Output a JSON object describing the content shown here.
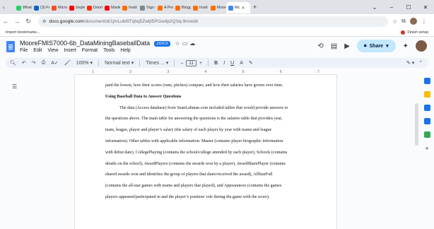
{
  "tabs": [
    {
      "label": "What",
      "color": "#25d366"
    },
    {
      "label": "(3) Fe",
      "color": "#0a66c2"
    },
    {
      "label": "Micro",
      "color": "#f25022"
    },
    {
      "label": "Septe",
      "color": "#ff0000"
    },
    {
      "label": "DoorL",
      "color": "#ff3008"
    },
    {
      "label": "Martir",
      "color": "#ff0000"
    },
    {
      "label": "Insid",
      "color": "#ff6d00"
    },
    {
      "label": "Sign i",
      "color": "#7b8794"
    },
    {
      "label": "A Pers",
      "color": "#ff6d00"
    },
    {
      "label": "Blogg",
      "color": "#ff6d00"
    },
    {
      "label": "Insid",
      "color": "#ff6d00"
    },
    {
      "label": "Moore",
      "color": "#ff6d00"
    }
  ],
  "active_tab": {
    "label": "Mc",
    "color": "#4285f4"
  },
  "address": {
    "domain": "docs.google.com",
    "path": "/document/d/1jmLubt9Tqhq5Zwljt5Pt1wdp2QSq-9m/edit"
  },
  "bookmarks": {
    "import_label": "Import bookmarks...",
    "finish_setup": "Finish setup"
  },
  "doc": {
    "title": "MooreFMIS7000-6b_DataMiningBaseballData",
    "badge": ".DOCX",
    "menus": [
      "File",
      "Edit",
      "View",
      "Insert",
      "Format",
      "Tools",
      "Help"
    ],
    "share_label": "Share"
  },
  "toolbar": {
    "zoom": "100%",
    "style": "Normal text",
    "font": "Times ...",
    "font_size": "11"
  },
  "ruler_ticks": [
    "1",
    "2",
    "3",
    "4",
    "5",
    "6",
    "7"
  ],
  "body": {
    "line0": "paid the lowest, how their scores (runs, pitches) compare, and how their salaries have grown over time.",
    "heading": "Using Baseball Data to Answer Questions",
    "para": [
      "The data (Access database) from SeanLahman.com included tables that would provide answers to",
      "the questions above. The main table for answering the questions is the salaries table that provides year,",
      "team, league, player and player’s salary (the salary of each player by year with teams and league",
      "information). Other tables with applicable information: Master (contains player biographic information",
      "with debut date), CollegePlaying (contains the school/college attended by each player), Schools (contains",
      "details on the school), AwardPlayers (contains the awards won by a player), AwardSharePlayer (contains",
      "shared awards won and identifies the group of players that share/received the award), AllStarFull",
      "(contains the all-star games with teams and players that played), and Appearances (contains the games",
      "players appeared/participated in and the player’s position/ role during the game with the score)."
    ]
  },
  "sidebar_icons": [
    {
      "name": "calendar-icon",
      "color": "#1a73e8"
    },
    {
      "name": "keep-icon",
      "color": "#fbbc04"
    },
    {
      "name": "tasks-icon",
      "color": "#1a73e8"
    },
    {
      "name": "contacts-icon",
      "color": "#1a73e8"
    },
    {
      "name": "maps-icon",
      "color": "#34a853"
    }
  ]
}
